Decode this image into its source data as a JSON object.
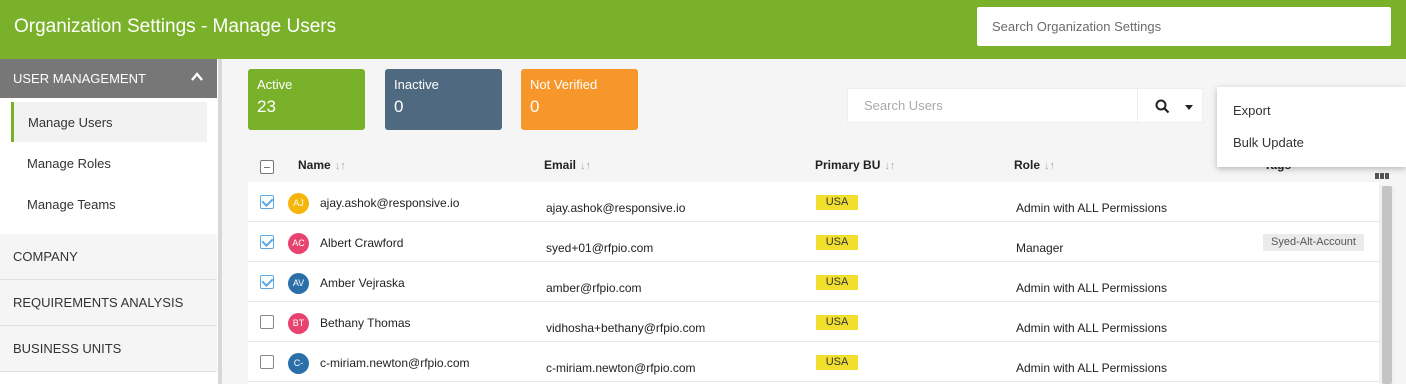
{
  "header": {
    "title": "Organization Settings - Manage Users",
    "search_placeholder": "Search Organization Settings"
  },
  "sidebar": {
    "section_title": "USER MANAGEMENT",
    "items": [
      {
        "label": "Manage Users",
        "active": true
      },
      {
        "label": "Manage Roles",
        "active": false
      },
      {
        "label": "Manage Teams",
        "active": false
      }
    ],
    "sections": [
      "COMPANY",
      "REQUIREMENTS ANALYSIS",
      "BUSINESS UNITS"
    ]
  },
  "stats": [
    {
      "label": "Active",
      "count": "23",
      "color": "#7ab12a"
    },
    {
      "label": "Inactive",
      "count": "0",
      "color": "#4f6a80"
    },
    {
      "label": "Not Verified",
      "count": "0",
      "color": "#f7962a"
    }
  ],
  "search": {
    "placeholder": "Search Users"
  },
  "menu": {
    "items": [
      "Export",
      "Bulk Update"
    ]
  },
  "table": {
    "columns": [
      "Name",
      "Email",
      "Primary BU",
      "Role",
      "Tags"
    ],
    "sort_glyph": "↓↑",
    "rows": [
      {
        "initials": "AJ",
        "avatar_color": "#f5b50a",
        "name": "ajay.ashok@responsive.io",
        "email": "ajay.ashok@responsive.io",
        "bu": "USA",
        "role": "Admin with ALL Permissions",
        "tag": "",
        "checked": true
      },
      {
        "initials": "AC",
        "avatar_color": "#e8436f",
        "name": "Albert Crawford",
        "email": "syed+01@rfpio.com",
        "bu": "USA",
        "role": "Manager",
        "tag": "Syed-Alt-Account",
        "checked": true
      },
      {
        "initials": "AV",
        "avatar_color": "#2a6fa8",
        "name": "Amber Vejraska",
        "email": "amber@rfpio.com",
        "bu": "USA",
        "role": "Admin with ALL Permissions",
        "tag": "",
        "checked": true
      },
      {
        "initials": "BT",
        "avatar_color": "#e8436f",
        "name": "Bethany Thomas",
        "email": "vidhosha+bethany@rfpio.com",
        "bu": "USA",
        "role": "Admin with ALL Permissions",
        "tag": "",
        "checked": false
      },
      {
        "initials": "C-",
        "avatar_color": "#2a6fa8",
        "name": "c-miriam.newton@rfpio.com",
        "email": "c-miriam.newton@rfpio.com",
        "bu": "USA",
        "role": "Admin with ALL Permissions",
        "tag": "",
        "checked": false
      }
    ]
  }
}
